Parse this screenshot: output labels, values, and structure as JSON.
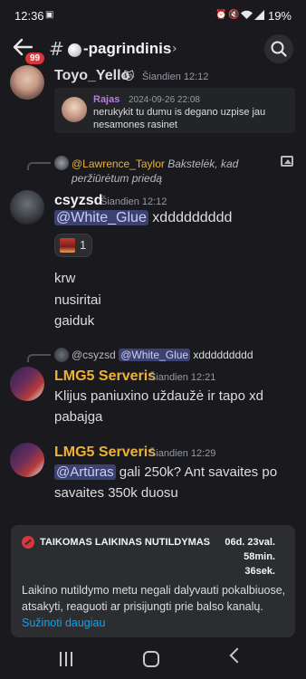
{
  "status_bar": {
    "time": "12:36",
    "battery": "19%",
    "icons": [
      "app-notification-icon",
      "alarm-icon",
      "mute-icon",
      "wifi-icon",
      "signal-icon",
      "battery-icon"
    ]
  },
  "header": {
    "unread_badge": "99",
    "hash": "#",
    "channel_name": "-pagrindinis",
    "chevron": "›"
  },
  "messages": [
    {
      "username": "Toyo_Yello",
      "user_color": "#dbdee1",
      "badge_emoji": "🐱",
      "timestamp": "Šiandien 12:12",
      "embed": {
        "user": "Rajas",
        "date": "2024-09-26 22:08",
        "text": "nerukykit tu dumu is degano uzpise jau nesamones rasinet"
      }
    },
    {
      "reply": {
        "user": "@Lawrence_Taylor",
        "text": "Bakstelėk, kad peržiūrėtum priedą"
      },
      "username": "csyzsd",
      "user_color": "#f2f3f5",
      "timestamp": "Šiandien 12:12",
      "mention": "@White_Glue",
      "text_after_mention": " xddddddddd",
      "reaction_count": "1",
      "extra_lines": [
        "krw",
        "nusiritai",
        "gaiduk"
      ]
    },
    {
      "reply": {
        "user": "@csyzsd",
        "mention": "@White_Glue",
        "text": " xddddddddd"
      },
      "username": "LMG5 Serveris",
      "user_color": "#f0b232",
      "timestamp": "Šiandien 12:21",
      "text": "Klijus paniuxino uždaužė ir tapo xd pabajga"
    },
    {
      "username": "LMG5 Serveris",
      "user_color": "#f0b232",
      "timestamp": "Šiandien 12:29",
      "mention": "@Artūras",
      "text_after_mention": " gali 250k? Ant savaites po savaites 350k duosu"
    }
  ],
  "timeout_notice": {
    "title": "TAIKOMAS LAIKINAS NUTILDYMAS",
    "timer_days": "06d.",
    "timer_hours": "23val.",
    "timer_minutes": "58min.",
    "timer_seconds": "36sek.",
    "body": "Laikino nutildymo metu negali dalyvauti pokalbiuose, atsakyti, reaguoti ar prisijungti prie balso kanalų.",
    "link": "Sužinoti daugiau"
  },
  "colors": {
    "background": "#1a1a1e",
    "mention_bg": "#3c4270",
    "accent_gold": "#f0b232",
    "link_blue": "#00a8fc",
    "badge_red": "#da373c"
  }
}
